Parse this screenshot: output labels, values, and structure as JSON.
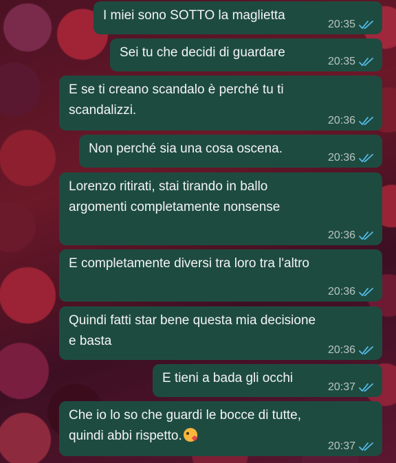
{
  "messages": [
    {
      "text": "I miei sono SOTTO la maglietta",
      "time": "20:35"
    },
    {
      "text": "Sei tu che decidi di guardare",
      "time": "20:35"
    },
    {
      "text": "E se ti creano scandalo è perché tu ti\nscandalizzi.",
      "time": "20:36"
    },
    {
      "text": "Non perché sia una cosa oscena.",
      "time": "20:36"
    },
    {
      "text": "Lorenzo ritirati, stai tirando in ballo\nargomenti completamente nonsense",
      "time": "20:36"
    },
    {
      "text": "E completamente diversi tra loro tra l'altro",
      "time": "20:36"
    },
    {
      "text": "Quindi fatti star bene questa mia decisione\ne basta",
      "time": "20:36"
    },
    {
      "text": "E tieni a bada gli occhi",
      "time": "20:37"
    },
    {
      "text": "Che io lo so che guardi le bocce di tutte,\nquindi abbi rispetto.",
      "time": "20:37",
      "emoji": "kissing-face-emoji"
    }
  ],
  "colors": {
    "bubble": "#1e4b40",
    "text": "#f3f5f4",
    "meta": "#b8c6c1",
    "read_check": "#53bdeb"
  },
  "icons": {
    "status": "double-check-read-icon"
  }
}
